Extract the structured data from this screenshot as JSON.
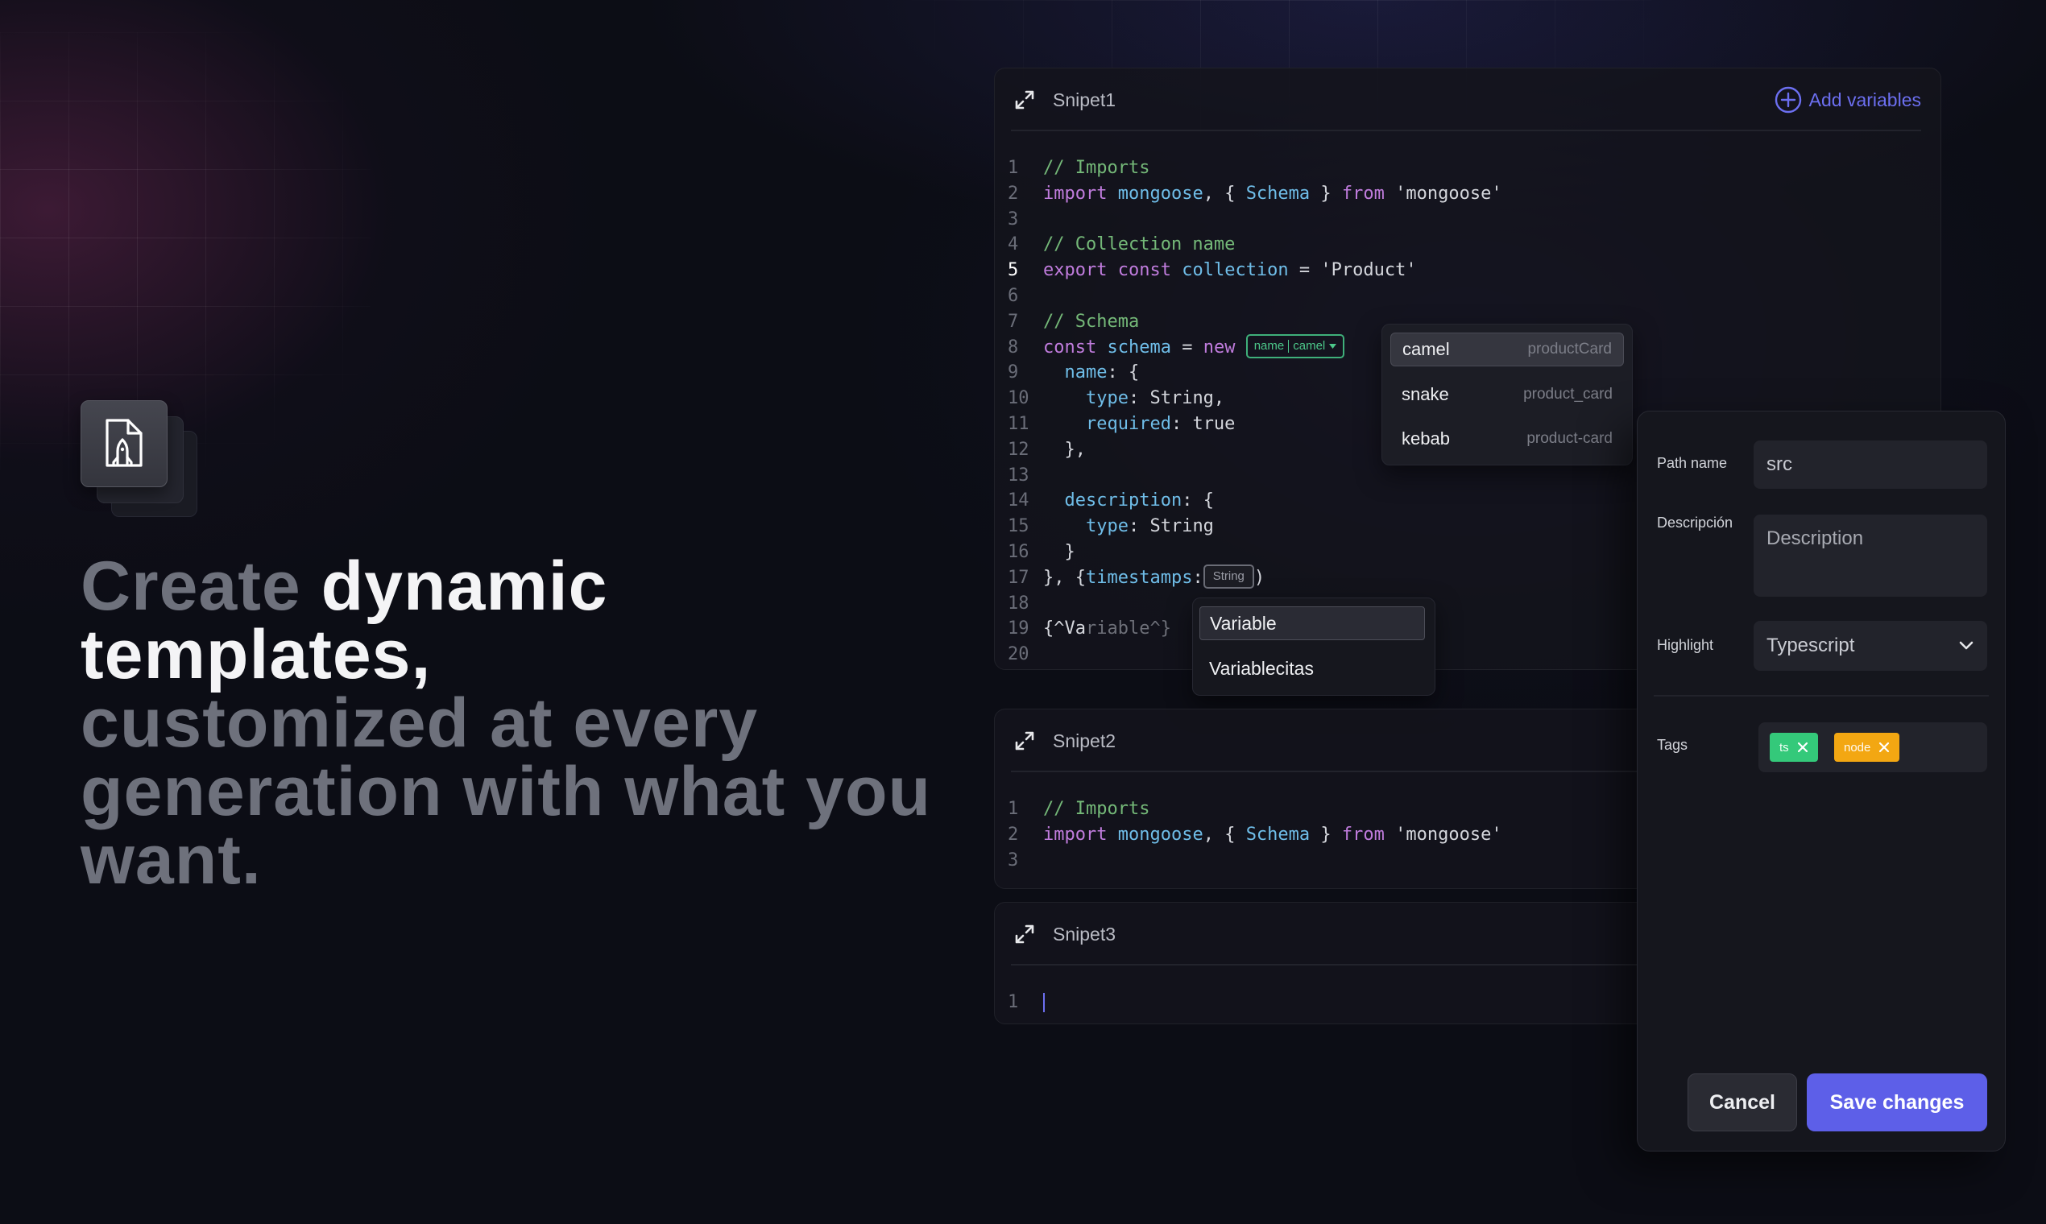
{
  "headline": {
    "part1": "Create ",
    "part2": "dynamic templates,",
    "part3": "customized at every generation with what you want."
  },
  "snippet1": {
    "title": "Snipet1",
    "add_variables_label": "Add variables",
    "active_line": 5,
    "lines": [
      {
        "n": "1"
      },
      {
        "n": "2"
      },
      {
        "n": "3"
      },
      {
        "n": "4"
      },
      {
        "n": "5"
      },
      {
        "n": "6"
      },
      {
        "n": "7"
      },
      {
        "n": "8"
      },
      {
        "n": "9"
      },
      {
        "n": "10"
      },
      {
        "n": "11"
      },
      {
        "n": "12"
      },
      {
        "n": "13"
      },
      {
        "n": "14"
      },
      {
        "n": "15"
      },
      {
        "n": "16"
      },
      {
        "n": "17"
      },
      {
        "n": "18"
      },
      {
        "n": "19"
      },
      {
        "n": "20"
      }
    ],
    "code": {
      "l1_comment": "// Imports",
      "l2_import": "import",
      "l2_mongoose": "mongoose",
      "l2_brace_open": ", { ",
      "l2_schema": "Schema",
      "l2_brace_close": " } ",
      "l2_from": "from",
      "l2_module": " 'mongoose'",
      "l4_comment": "// Collection name",
      "l5_export": "export",
      "l5_const": "const",
      "l5_collection": "collection",
      "l5_rest": " = 'Product'",
      "l7_comment": "// Schema",
      "l8_const": "const",
      "l8_schema": "schema",
      "l8_eq": " = ",
      "l8_new": "new",
      "l9_name": "name",
      "l9_rest": ": {",
      "l10_type": "type",
      "l10_rest": ": String,",
      "l11_required": "required",
      "l11_rest": ": true",
      "l12": "},",
      "l14_description": "description",
      "l14_rest": ": {",
      "l15_type": "type",
      "l15_rest": ": String",
      "l16": "}",
      "l17_start": "}, {",
      "l17_timestamps": "timestamps",
      "l17_colon": ":",
      "l17_end": ")",
      "l19_typed": "{^Va",
      "l19_ghost": "riable^}"
    },
    "name_chip": {
      "left": "name",
      "right": "camel"
    },
    "string_chip": "String"
  },
  "case_menu": {
    "items": [
      {
        "name": "camel",
        "example": "productCard",
        "selected": true
      },
      {
        "name": "snake",
        "example": "product_card",
        "selected": false
      },
      {
        "name": "kebab",
        "example": "product-card",
        "selected": false
      }
    ]
  },
  "variable_menu": {
    "items": [
      {
        "label": "Variable",
        "selected": true
      },
      {
        "label": "Variablecitas",
        "selected": false
      }
    ]
  },
  "snippet2": {
    "title": "Snipet2",
    "lines": [
      {
        "n": "1"
      },
      {
        "n": "2"
      },
      {
        "n": "3"
      }
    ],
    "code": {
      "l1_comment": "// Imports",
      "l2_import": "import",
      "l2_mongoose": "mongoose",
      "l2_brace_open": ", { ",
      "l2_schema": "Schema",
      "l2_brace_close": " } ",
      "l2_from": "from",
      "l2_module": " 'mongoose'"
    }
  },
  "snippet3": {
    "title": "Snipet3",
    "lines": [
      {
        "n": "1"
      }
    ]
  },
  "panel": {
    "path_label": "Path name",
    "path_value": "src",
    "description_label": "Descripción",
    "description_placeholder": "Description",
    "highlight_label": "Highlight",
    "highlight_value": "Typescript",
    "tags_label": "Tags",
    "tags": [
      {
        "label": "ts",
        "color": "#34c97a"
      },
      {
        "label": "node",
        "color": "#f3a712"
      }
    ],
    "cancel_label": "Cancel",
    "save_label": "Save changes"
  },
  "colors": {
    "accent": "#5d5fe8",
    "keyword": "#c07cdd",
    "identifier": "#6fbde8",
    "comment": "#74b878"
  },
  "icons": {
    "app_icon": "rocket-file-icon",
    "expand_icon": "expand-arrows-icon",
    "add_icon": "plus-circle-icon",
    "chevron_icon": "chevron-down-icon",
    "remove_icon": "close-icon"
  }
}
